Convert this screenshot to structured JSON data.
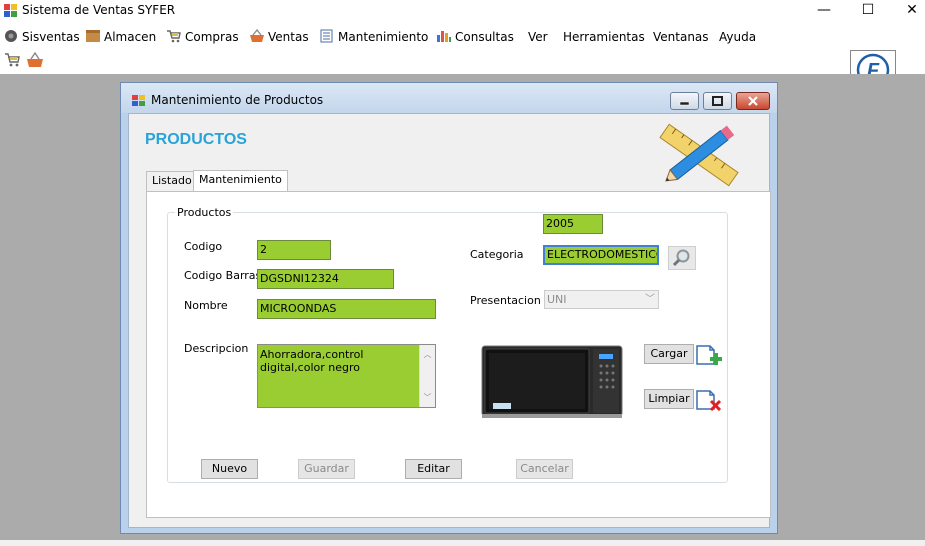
{
  "app": {
    "title": "Sistema de Ventas SYFER"
  },
  "window_controls": {
    "minimize": "—",
    "maximize": "☐",
    "close": "✕"
  },
  "menu": [
    {
      "label": "Sisventas",
      "icon": "gear-globe-icon"
    },
    {
      "label": "Almacen",
      "icon": "box-icon"
    },
    {
      "label": "Compras",
      "icon": "cart-icon"
    },
    {
      "label": "Ventas",
      "icon": "basket-icon"
    },
    {
      "label": "Mantenimiento",
      "icon": "notebook-icon"
    },
    {
      "label": "Consultas",
      "icon": "bar-chart-icon"
    },
    {
      "label": "Ver"
    },
    {
      "label": "Herramientas"
    },
    {
      "label": "Ventanas"
    },
    {
      "label": "Ayuda"
    }
  ],
  "toolbar": {
    "icons": [
      "cart-icon",
      "basket-icon"
    ]
  },
  "brand_logo": {
    "letter": "F",
    "color": "#1e5fa8"
  },
  "child": {
    "title": "Mantenimiento de Productos",
    "heading": "PRODUCTOS",
    "tabs": [
      {
        "label": "Listado",
        "active": false
      },
      {
        "label": "Mantenimiento",
        "active": true
      }
    ],
    "group_title": "Productos",
    "form": {
      "codigo_label": "Codigo",
      "codigo_value": "2",
      "codigo_barras_label": "Codigo Barras",
      "codigo_barras_value": "DGSDNI12324",
      "nombre_label": "Nombre",
      "nombre_value": "MICROONDAS",
      "descripcion_label": "Descripcion",
      "descripcion_value": "Ahorradora,control digital,color negro",
      "categoria_label": "Categoria",
      "categoria_id": "2005",
      "categoria_value": "ELECTRODOMESTICOS",
      "presentacion_label": "Presentacion",
      "presentacion_value": "UNI"
    },
    "image_buttons": {
      "cargar": "Cargar",
      "limpiar": "Limpiar"
    },
    "actions": {
      "nuevo": "Nuevo",
      "guardar": "Guardar",
      "editar": "Editar",
      "cancelar": "Cancelar"
    }
  },
  "colors": {
    "field_green": "#9acd32",
    "heading_blue": "#29a3d8",
    "mdi_gray": "#ababab"
  }
}
